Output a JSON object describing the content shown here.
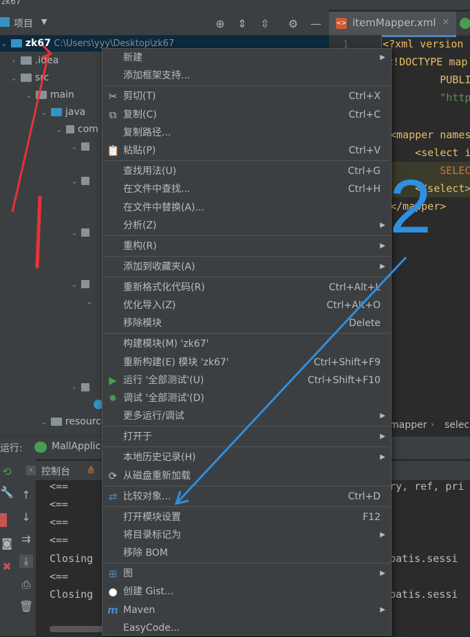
{
  "window": {
    "title_fragment": "zk67"
  },
  "project_panel": {
    "title": "项目",
    "tree": [
      {
        "label": "zk67",
        "path": "C:\\Users\\yyy\\Desktop\\zk67"
      },
      {
        "label": ".idea"
      },
      {
        "label": "src"
      },
      {
        "label": "main"
      },
      {
        "label": "java"
      },
      {
        "label": "com"
      },
      {
        "label": "resources"
      }
    ]
  },
  "editor": {
    "tab_label": "itemMapper.xml",
    "code_lines": [
      "<?xml version",
      "<!DOCTYPE map",
      "        PUBLI",
      "        \"http",
      "",
      "<mapper names",
      "    <select i",
      "        SELEC",
      "    </select>",
      "</mapper>"
    ],
    "breadcrumb": [
      "mapper",
      "selec"
    ]
  },
  "run_panel": {
    "label": "运行:",
    "config": "MallApplic",
    "console_tab": "控制台",
    "console_lines": [
      "<==",
      "<==",
      "<==",
      "<==",
      "Closing",
      "<==",
      "Closing"
    ],
    "console_right": [
      "ry, ref, pri",
      "batis.sessi",
      "batis.sessi"
    ]
  },
  "context_menu": {
    "items": [
      {
        "label": "新建",
        "submenu": true
      },
      {
        "label": "添加框架支持..."
      },
      {
        "label": "剪切(T)",
        "shortcut": "Ctrl+X",
        "icon": "scissors-icon"
      },
      {
        "label": "复制(C)",
        "shortcut": "Ctrl+C",
        "icon": "copy-icon"
      },
      {
        "label": "复制路径..."
      },
      {
        "label": "粘贴(P)",
        "shortcut": "Ctrl+V",
        "icon": "paste-icon"
      },
      {
        "label": "查找用法(U)",
        "shortcut": "Ctrl+G"
      },
      {
        "label": "在文件中查找...",
        "shortcut": "Ctrl+H"
      },
      {
        "label": "在文件中替换(A)..."
      },
      {
        "label": "分析(Z)",
        "submenu": true
      },
      {
        "label": "重构(R)",
        "submenu": true
      },
      {
        "label": "添加到收藏夹(A)",
        "submenu": true
      },
      {
        "label": "重新格式化代码(R)",
        "shortcut": "Ctrl+Alt+L"
      },
      {
        "label": "优化导入(Z)",
        "shortcut": "Ctrl+Alt+O"
      },
      {
        "label": "移除模块",
        "shortcut": "Delete"
      },
      {
        "label": "构建模块(M) 'zk67'"
      },
      {
        "label": "重新构建(E) 模块 'zk67'",
        "shortcut": "Ctrl+Shift+F9"
      },
      {
        "label": "运行 '全部测试'(U)",
        "shortcut": "Ctrl+Shift+F10",
        "icon": "run-icon"
      },
      {
        "label": "调试 '全部测试'(D)",
        "icon": "debug-icon"
      },
      {
        "label": "更多运行/调试",
        "submenu": true
      },
      {
        "label": "打开于",
        "submenu": true
      },
      {
        "label": "本地历史记录(H)",
        "submenu": true
      },
      {
        "label": "从磁盘重新加载",
        "icon": "reload-icon"
      },
      {
        "label": "比较对象...",
        "shortcut": "Ctrl+D",
        "icon": "compare-icon"
      },
      {
        "label": "打开模块设置",
        "shortcut": "F12"
      },
      {
        "label": "将目录标记为",
        "submenu": true
      },
      {
        "label": "移除 BOM"
      },
      {
        "label": "图",
        "submenu": true,
        "icon": "diagram-icon"
      },
      {
        "label": "创建 Gist...",
        "icon": "github-icon"
      },
      {
        "label": "Maven",
        "submenu": true,
        "icon": "maven-icon"
      },
      {
        "label": "EasyCode..."
      }
    ]
  },
  "annotations": {
    "number_label": "2"
  },
  "colors": {
    "menu_bg": "#3c3f41",
    "annotation_red": "#e8323c",
    "annotation_blue": "#2f8fe0"
  }
}
